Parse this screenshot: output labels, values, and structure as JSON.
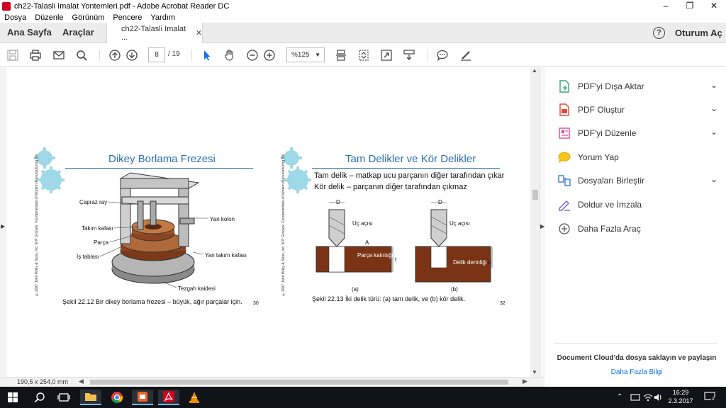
{
  "window": {
    "title": "ch22-Talasli Imalat Yontemleri.pdf - Adobe Acrobat Reader DC",
    "controls": {
      "minimize": "–",
      "maximize": "❐",
      "close": "✕"
    }
  },
  "menu": [
    "Dosya",
    "Düzenle",
    "Görünüm",
    "Pencere",
    "Yardım"
  ],
  "tabs": {
    "home": "Ana Sayfa",
    "tools": "Araçlar",
    "document": "ch22-Talasli Imalat ...",
    "close": "✕"
  },
  "header": {
    "help": "?",
    "signin": "Oturum Aç"
  },
  "toolbar": {
    "page_current": "8",
    "page_total": "/ 19",
    "zoom": "%125"
  },
  "slide1": {
    "title": "Dikey Borlama Frezesi",
    "labels": {
      "cross_rail": "Çapraz ray",
      "side_column": "Yan kolon",
      "tool_head": "Takım kafası",
      "part": "Parça",
      "side_tool_head": "Yan takım kafası",
      "worktable": "İş tablası",
      "base": "Tezgah kaidesi"
    },
    "caption": "Şekil 22.12  Bir dikey borlama frezesi – büyük, ağır parçalar için.",
    "page": "30",
    "vertical_note": "©2007 John Wiley & Sons, Inc. M P Groover, Fundamentals of Modern Manufacturing 3/e"
  },
  "slide2": {
    "title": "Tam Delikler ve Kör Delikler",
    "bullets": [
      "Tam delik – matkap ucu parçanın diğer tarafından çıkar",
      "Kör delik – parçanın diğer tarafından çıkmaz"
    ],
    "labels": {
      "d_a": "D",
      "d_b": "D",
      "angle_a": "Uç açısı",
      "angle_b": "Uç açısı",
      "a_mark": "A",
      "part": "Parça kalınlığı",
      "t": "t",
      "hole_depth": "Delik derinliği",
      "d": "d",
      "a": "(a)",
      "b": "(b)"
    },
    "caption": "Şekil 22.13 İki delik türü: (a) tam delik, ve (b) kör delik.",
    "page": "32",
    "vertical_note": "©2007 John Wiley & Sons, Inc. M P Groover, Fundamentals of Modern Manufacturing 3/e"
  },
  "rightpanel": {
    "tools": [
      {
        "label": "PDF'yi Dışa Aktar",
        "icon": "export-pdf-icon",
        "expandable": true
      },
      {
        "label": "PDF Oluştur",
        "icon": "create-pdf-icon",
        "expandable": true
      },
      {
        "label": "PDF'yi Düzenle",
        "icon": "edit-pdf-icon",
        "expandable": true
      },
      {
        "label": "Yorum Yap",
        "icon": "comment-icon",
        "expandable": false
      },
      {
        "label": "Dosyaları Birleştir",
        "icon": "combine-files-icon",
        "expandable": true
      },
      {
        "label": "Doldur ve İmzala",
        "icon": "fill-sign-icon",
        "expandable": false
      },
      {
        "label": "Daha Fazla Araç",
        "icon": "more-tools-icon",
        "expandable": false
      }
    ],
    "cloud_text": "Document Cloud'da dosya saklayın ve paylaşın",
    "cloud_link": "Daha Fazla Bilgi"
  },
  "status": {
    "dimensions": "190,5 x 254,0 mm"
  },
  "taskbar": {
    "time": "16:29",
    "date": "2.3.2017",
    "notifications": "2"
  },
  "colors": {
    "accent_blue": "#2a6fb0",
    "acrobat_red": "#d0021b",
    "link_blue": "#1473e6",
    "brown": "#7a3415"
  }
}
